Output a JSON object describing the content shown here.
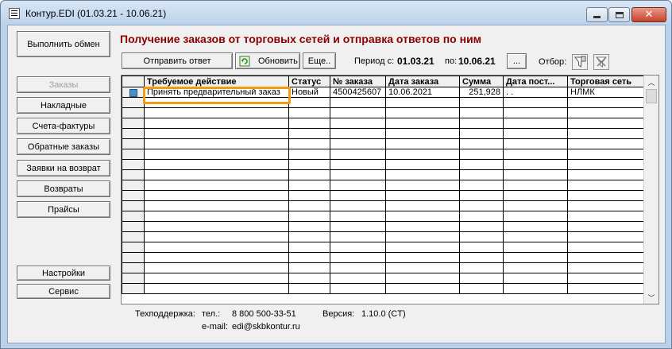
{
  "window": {
    "title": "Контур.EDI (01.03.21 - 10.06.21)"
  },
  "left_panel": {
    "exchange_button": "Выполнить обмен",
    "nav": [
      {
        "label": "Заказы",
        "disabled": true
      },
      {
        "label": "Накладные"
      },
      {
        "label": "Счета-фактуры"
      },
      {
        "label": "Обратные заказы"
      },
      {
        "label": "Заявки на возврат"
      },
      {
        "label": "Возвраты"
      },
      {
        "label": "Прайсы"
      }
    ],
    "settings_button": "Настройки",
    "service_button": "Сервис"
  },
  "main": {
    "heading": "Получение заказов от торговых сетей и отправка ответов по ним",
    "toolbar": {
      "send_reply": "Отправить ответ",
      "refresh": "Обновить",
      "more": "Еще..",
      "period_from_label": "Период с:",
      "period_from": "01.03.21",
      "period_to_label": "по:",
      "period_to": "10.06.21",
      "period_button": "...",
      "filter_label": "Отбор:"
    },
    "table": {
      "columns": [
        "Требуемое действие",
        "Статус",
        "№ заказа",
        "Дата заказа",
        "Сумма",
        "Дата пост...",
        "Торговая сеть"
      ],
      "rows": [
        [
          "Принять предварительный заказ",
          "Новый",
          "4500425607",
          "10.06.2021",
          "251,928",
          " . .",
          "НЛМК"
        ]
      ],
      "empty_rows": 19
    }
  },
  "footer": {
    "support_label": "Техподдержка:",
    "phone_label": "тел.:",
    "phone": "8 800 500-33-51",
    "email_label": "e-mail:",
    "email": "edi@skbkontur.ru",
    "version_label": "Версия:",
    "version": "1.10.0 (CT)"
  },
  "colors": {
    "heading": "#8b0000",
    "highlight": "#f39c12",
    "frame": "#b9d1ea"
  }
}
